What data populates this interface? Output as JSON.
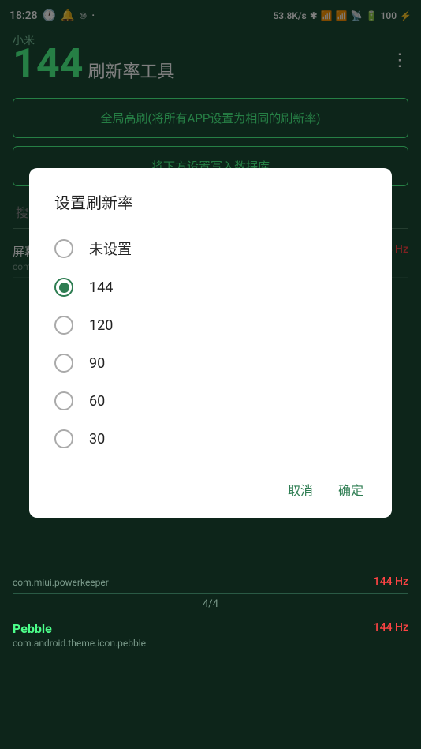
{
  "statusBar": {
    "time": "18:28",
    "network": "53.8K/s",
    "battery": "100"
  },
  "appBar": {
    "titleNumber": "144",
    "titleText": "刷新率工具",
    "menuIcon": "⋮"
  },
  "buttons": {
    "globalRefresh": "全局高刷(将所有APP设置为相同的刷新率)",
    "writeDatabase": "将下方设置写入数据库"
  },
  "search": {
    "placeholder": "搜索应用..."
  },
  "appList": [
    {
      "name": "屏幕录制",
      "package": "com.miui.screenrecorder",
      "hz": "144 Hz"
    },
    {
      "name": "",
      "package": "",
      "hz": "144 Hz"
    },
    {
      "name": "Pebble",
      "package": "com.android.theme.icon.pebble",
      "hz": "144 Hz"
    }
  ],
  "bgItems": [
    {
      "name": "com.miui.powerkeeper",
      "hz": "144 Hz"
    }
  ],
  "pageIndicator": "4/4",
  "dialog": {
    "title": "设置刷新率",
    "options": [
      {
        "label": "未设置",
        "value": "none",
        "selected": false
      },
      {
        "label": "144",
        "value": "144",
        "selected": true
      },
      {
        "label": "120",
        "value": "120",
        "selected": false
      },
      {
        "label": "90",
        "value": "90",
        "selected": false
      },
      {
        "label": "60",
        "value": "60",
        "selected": false
      },
      {
        "label": "30",
        "value": "30",
        "selected": false
      }
    ],
    "cancelLabel": "取消",
    "confirmLabel": "确定"
  }
}
